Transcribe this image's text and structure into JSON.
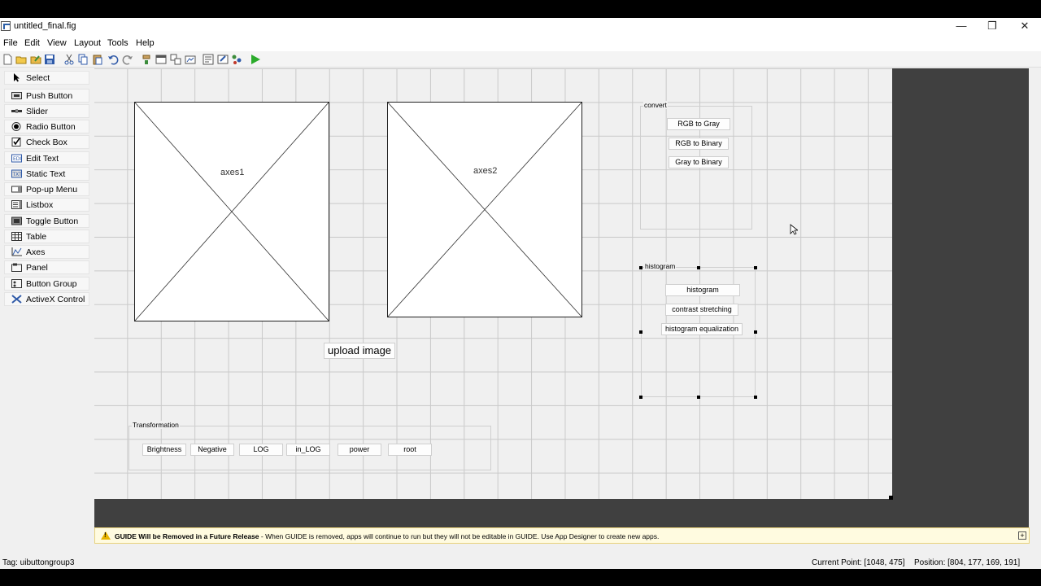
{
  "window": {
    "title": "untitled_final.fig",
    "minimize_glyph": "—",
    "restore_glyph": "❐",
    "close_glyph": "✕"
  },
  "menu": [
    "File",
    "Edit",
    "View",
    "Layout",
    "Tools",
    "Help"
  ],
  "toolbar_icons": [
    "new-icon",
    "open-icon",
    "open-recent-icon",
    "save-icon",
    "cut-icon",
    "copy-icon",
    "paste-icon",
    "undo-icon",
    "redo-icon",
    "align-icon",
    "menu-editor-icon",
    "tab-order-icon",
    "toolbar-editor-icon",
    "editor-icon",
    "property-inspector-icon",
    "object-browser-icon",
    "run-icon"
  ],
  "palette": [
    {
      "label": "Select",
      "icon": "arrow-cursor-icon"
    },
    {
      "label": "Push Button",
      "icon": "push-button-icon"
    },
    {
      "label": "Slider",
      "icon": "slider-icon"
    },
    {
      "label": "Radio Button",
      "icon": "radio-button-icon"
    },
    {
      "label": "Check Box",
      "icon": "checkbox-icon"
    },
    {
      "label": "Edit Text",
      "icon": "edit-text-icon"
    },
    {
      "label": "Static Text",
      "icon": "static-text-icon"
    },
    {
      "label": "Pop-up Menu",
      "icon": "popup-menu-icon"
    },
    {
      "label": "Listbox",
      "icon": "listbox-icon"
    },
    {
      "label": "Toggle Button",
      "icon": "toggle-button-icon"
    },
    {
      "label": "Table",
      "icon": "table-icon"
    },
    {
      "label": "Axes",
      "icon": "axes-icon"
    },
    {
      "label": "Panel",
      "icon": "panel-icon"
    },
    {
      "label": "Button Group",
      "icon": "button-group-icon"
    },
    {
      "label": "ActiveX Control",
      "icon": "activex-icon"
    }
  ],
  "canvas": {
    "axes1_label": "axes1",
    "axes2_label": "axes2",
    "upload_button": "upload image",
    "convert_panel": {
      "title": "convert",
      "buttons": [
        "RGB to Gray",
        "RGB to Binary",
        "Gray to Binary"
      ]
    },
    "histogram_panel": {
      "title": "histogram",
      "buttons": [
        "histogram",
        "contrast stretching",
        "histogram equalization"
      ]
    },
    "transformation_panel": {
      "title": "Transformation",
      "buttons": [
        "Brightness",
        "Negative",
        "LOG",
        "in_LOG",
        "power",
        "root"
      ]
    }
  },
  "warning": {
    "bold": "GUIDE Will be Removed in a Future Release",
    "text": " - When GUIDE is removed, apps will continue to run but they will not be editable in GUIDE.  Use App Designer to create new apps.",
    "icon": "warning-icon",
    "expand_glyph": "+"
  },
  "status": {
    "tag": "Tag: uibuttongroup3",
    "current_point": "Current Point:  [1048, 475]",
    "position": "Position: [804, 177, 169, 191]"
  },
  "colors": {
    "canvas_bg": "#f0f0f0",
    "grid": "#c9c9c9",
    "dark_area": "#404040",
    "warning_bg": "#fffbe0",
    "run_green": "#2bab2b"
  }
}
